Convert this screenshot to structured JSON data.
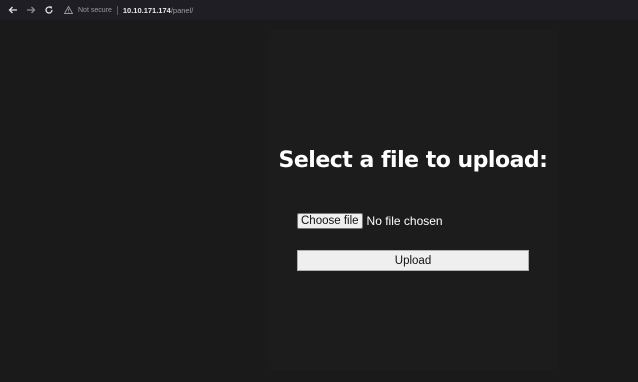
{
  "browser": {
    "security_label": "Not secure",
    "url_host": "10.10.171.174",
    "url_path": "/panel/",
    "icons": [
      "back-arrow-icon",
      "forward-arrow-icon",
      "reload-icon",
      "warning-icon"
    ]
  },
  "form": {
    "title": "Select a file to upload:",
    "choose_file_label": "Choose file",
    "file_status": "No file chosen",
    "upload_label": "Upload"
  },
  "colors": {
    "background": "#1a1a1a",
    "toolbar": "#1e1e24",
    "button": "#efefef",
    "title_text": "#ffffff"
  }
}
